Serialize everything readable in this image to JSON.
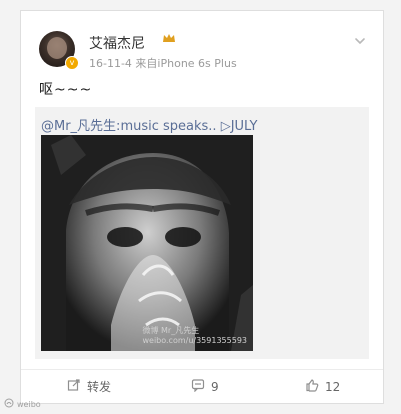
{
  "post": {
    "username": "艾福杰尼",
    "meta": "16-11-4  来自iPhone 6s Plus",
    "text": "呕~~~",
    "verified_badge": "v",
    "repost_line": "@Mr_凡先生:music speaks..  ▷JULY"
  },
  "image": {
    "watermark": "微博 Mr_凡先生",
    "url_text": "weibo.com/u/3591355593"
  },
  "actions": {
    "repost_label": "转发",
    "comments_count": "9",
    "likes_count": "12"
  },
  "corner_watermark": "weibo",
  "icons": {
    "more": "chevron-down-icon",
    "repost": "share-icon",
    "comment": "comment-icon",
    "like": "thumbs-up-icon",
    "crown": "crown-icon"
  },
  "colors": {
    "link": "#5a6e96",
    "verified": "#f2a900"
  }
}
